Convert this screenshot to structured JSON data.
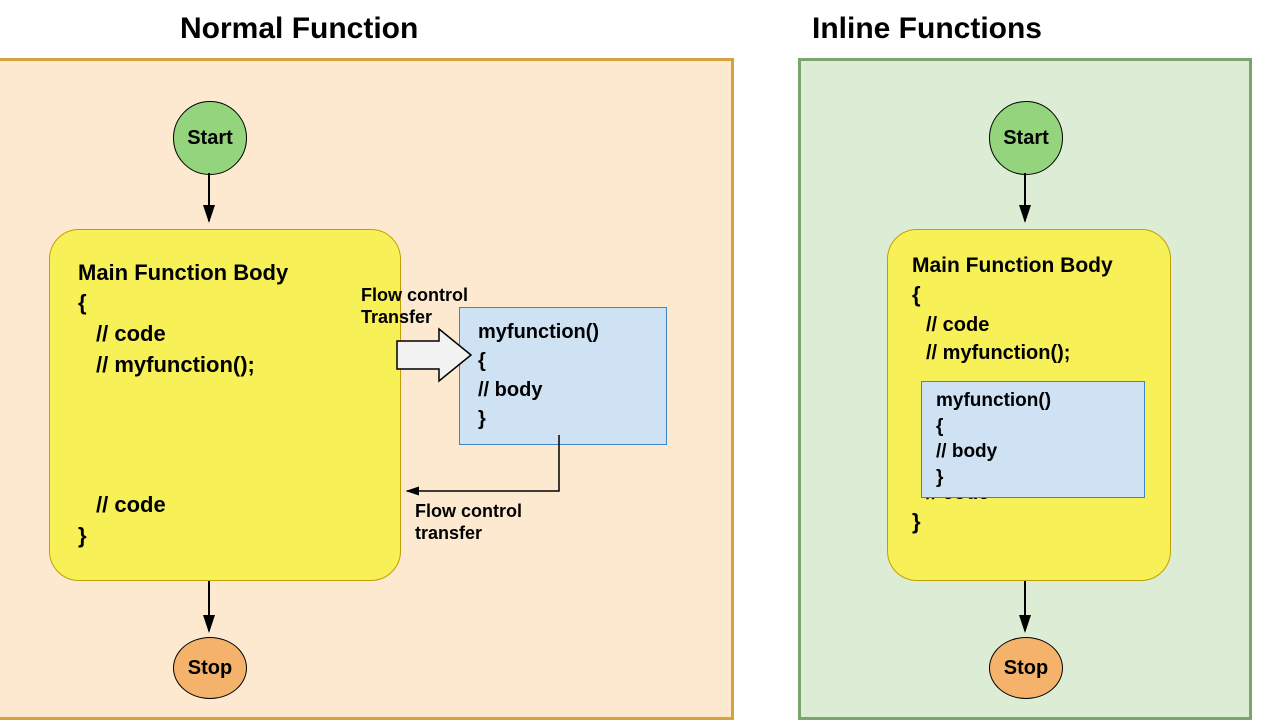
{
  "titles": {
    "left": "Normal Function",
    "right": "Inline Functions"
  },
  "nodes": {
    "start": "Start",
    "stop": "Stop"
  },
  "main": {
    "header": "Main Function Body",
    "brace_open": "{",
    "code1": "// code",
    "call": "// myfunction();",
    "code2": "// code",
    "brace_close": "}"
  },
  "func": {
    "name": "myfunction()",
    "brace_open": "{",
    "body": "// body",
    "brace_close": "}"
  },
  "anno": {
    "flow_out": "Flow control Transfer",
    "flow_back": "Flow control transfer"
  },
  "colors": {
    "panel_left_border": "#d4a33b",
    "panel_left_fill": "#fde9d0",
    "panel_right_border": "#7aa66e",
    "panel_right_fill": "#ddecd5"
  }
}
